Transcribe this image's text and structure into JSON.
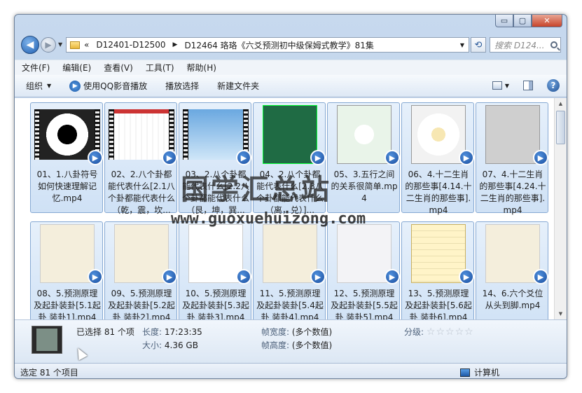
{
  "window": {
    "caption_buttons": [
      "▭",
      "▢",
      "✕"
    ]
  },
  "address": {
    "back_glyph": "◀",
    "forward_glyph": "▶",
    "overflow": "«",
    "crumbs": [
      "D12401-D12500",
      "D12464 珞珞《六爻预测初中级保姆式教学》81集"
    ],
    "separator": "▶",
    "refresh_glyph": "⟲",
    "search_placeholder": "搜索 D124..."
  },
  "menu": [
    "文件(F)",
    "编辑(E)",
    "查看(V)",
    "工具(T)",
    "帮助(H)"
  ],
  "toolbar": {
    "organize": "组织",
    "play_qq": "使用QQ影音播放",
    "play_selected": "播放选择",
    "new_folder": "新建文件夹",
    "help_glyph": "?"
  },
  "files": [
    {
      "name": "01、1.八卦符号如何快速理解记忆.mp4",
      "thumb": "bagua"
    },
    {
      "name": "02、2.八个卦都能代表什么[2.1八个卦都能代表什么（乾，震，坎...",
      "thumb": "hexlines"
    },
    {
      "name": "03、2.八个卦都能代表什么[2.2八个卦都能代表什么（艮，坤，巽...",
      "thumb": "sky"
    },
    {
      "name": "04、2.八个卦都能代表什么[2.3八个卦都能代表什么（离，兑）]...",
      "thumb": "greenlist"
    },
    {
      "name": "05、3.五行之间的关系很简单.mp4",
      "thumb": "wuxing"
    },
    {
      "name": "06、4.十二生肖的那些事[4.14.十二生肖的那些事].mp4",
      "thumb": "zodiac"
    },
    {
      "name": "07、4.十二生肖的那些事[4.24.十二生肖的那些事].mp4",
      "thumb": "graypaper"
    },
    {
      "name": "08、5.预测原理及起卦装卦[5.1起卦 装卦1].mp4",
      "thumb": "paper"
    },
    {
      "name": "09、5.预测原理及起卦装卦[5.2起卦 装卦2].mp4",
      "thumb": "paper"
    },
    {
      "name": "10、5.预测原理及起卦装卦[5.3起卦 装卦3].mp4",
      "thumb": "diagram"
    },
    {
      "name": "11、5.预测原理及起卦装卦[5.4起卦 装卦4].mp4",
      "thumb": "paper"
    },
    {
      "name": "12、5.预测原理及起卦装卦[5.5起卦 装卦5].mp4",
      "thumb": "paperlight"
    },
    {
      "name": "13、5.预测原理及起卦装卦[5.6起卦 装卦6].mp4",
      "thumb": "table"
    },
    {
      "name": "14、6.六个爻位从头到脚.mp4",
      "thumb": "paper"
    }
  ],
  "details": {
    "selected": "已选择 81 个项",
    "length_label": "长度:",
    "length_value": "17:23:35",
    "size_label": "大小:",
    "size_value": "4.36 GB",
    "frame_width_label": "帧宽度:",
    "frame_width_value": "(多个数值)",
    "frame_height_label": "帧高度:",
    "frame_height_value": "(多个数值)",
    "rating_label": "分级:",
    "rating_value": 0,
    "rating_max": 5
  },
  "status": {
    "left": "选定 81 个项目",
    "right": "计算机"
  },
  "watermark": {
    "line1": "国学汇总站",
    "line2": "www.guoxuehuizong.com"
  },
  "colors": {
    "accent": "#1b4fa0",
    "tile_selected": "#cfe1f5"
  }
}
